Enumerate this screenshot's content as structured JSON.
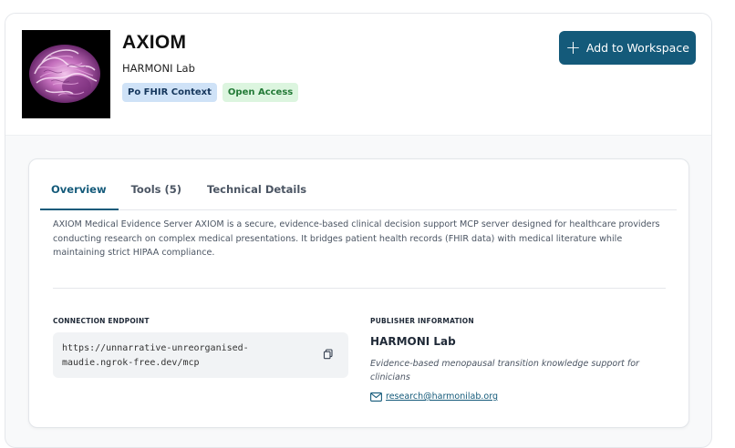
{
  "server": {
    "name": "AXIOM",
    "publisher": "HARMONI Lab",
    "badges": [
      "Po FHIR Context",
      "Open Access"
    ],
    "logo_icon": "brain-image-icon"
  },
  "actions": {
    "add_label": "Add to Workspace",
    "add_icon": "plus-icon"
  },
  "tabs": [
    {
      "label": "Overview",
      "active": true
    },
    {
      "label": "Tools (5)",
      "active": false
    },
    {
      "label": "Technical Details",
      "active": false
    }
  ],
  "overview": {
    "description": "AXIOM Medical Evidence Server AXIOM is a secure, evidence-based clinical decision support MCP server designed for healthcare providers conducting research on complex medical presentations. It bridges patient health records (FHIR data) with medical literature while maintaining strict HIPAA compliance.",
    "endpoint_label": "CONNECTION ENDPOINT",
    "endpoint_url": "https://unnarrative-unreorganised-maudie.ngrok-free.dev/mcp",
    "publisher_label": "PUBLISHER INFORMATION",
    "publisher_name": "HARMONI Lab",
    "publisher_description": "Evidence-based menopausal transition knowledge support for clinicians",
    "publisher_email": "research@harmonilab.org"
  },
  "colors": {
    "accent": "#145a7a",
    "badge_context_bg": "#cfe2f7",
    "badge_access_bg": "#dcf5df",
    "badge_access_text": "#237a37"
  }
}
